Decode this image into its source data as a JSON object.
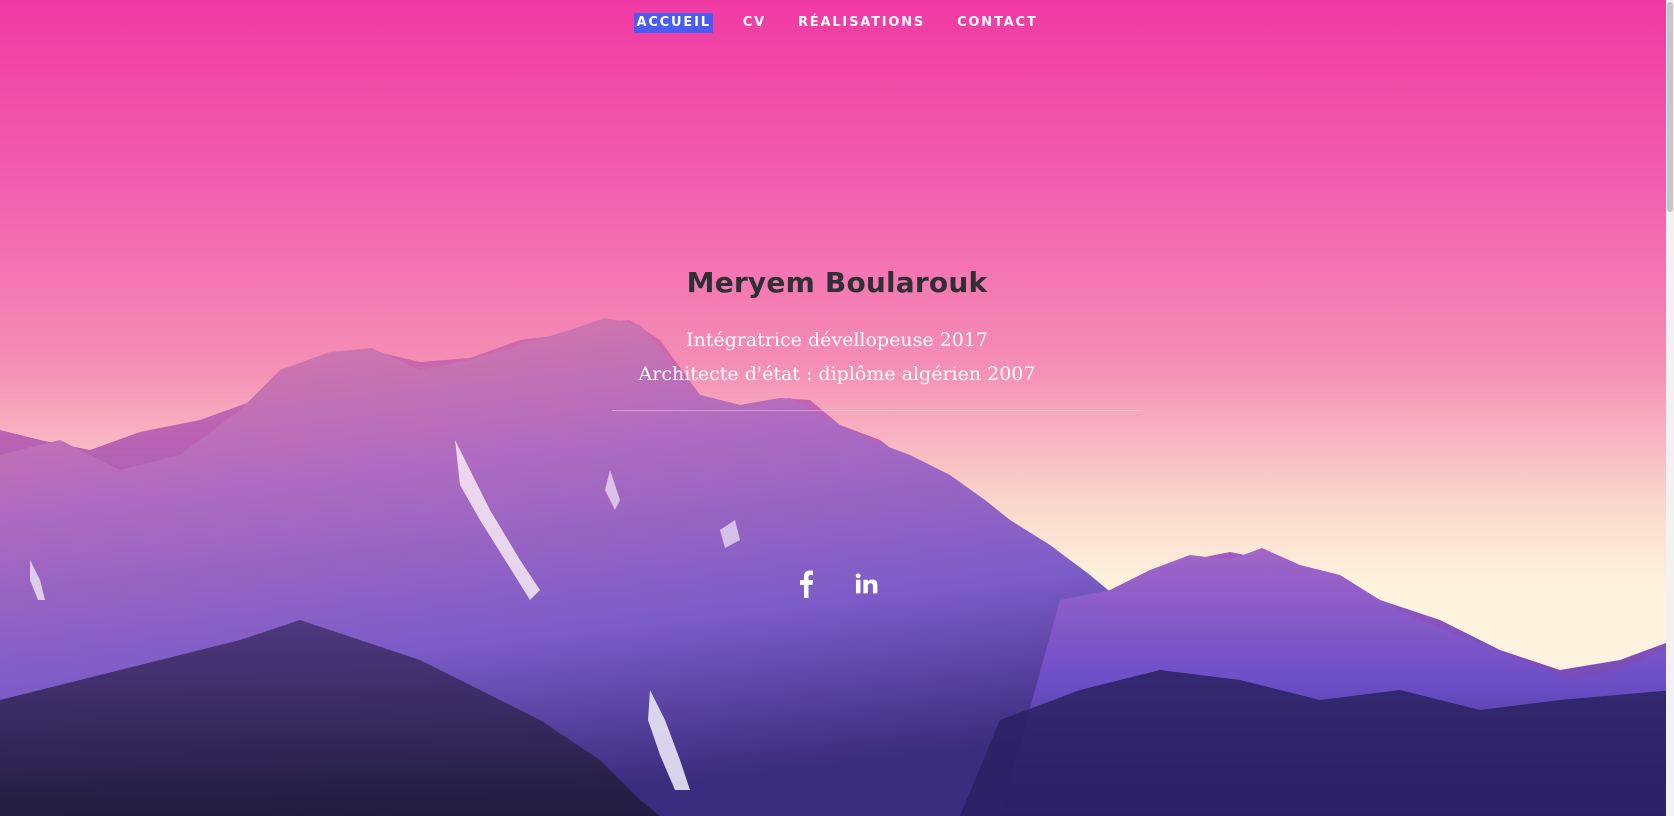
{
  "nav": {
    "items": [
      {
        "label": "ACCUEIL",
        "active": true
      },
      {
        "label": "CV",
        "active": false
      },
      {
        "label": "RÉALISATIONS",
        "active": false
      },
      {
        "label": "CONTACT",
        "active": false
      }
    ]
  },
  "hero": {
    "name": "Meryem Boularouk",
    "line1": "Intégratrice dévellopeuse 2017",
    "line2": "Architecte d'état : diplôme algérien 2007"
  },
  "social": {
    "facebook_icon": "facebook-icon",
    "linkedin_icon": "linkedin-icon"
  },
  "colors": {
    "sky_top": "#f03aa3",
    "nav_active_bg": "#4a5cf2",
    "name_text": "#2f2f35",
    "mountain_light": "#c98ac8",
    "mountain_dark": "#3b2a7a"
  }
}
